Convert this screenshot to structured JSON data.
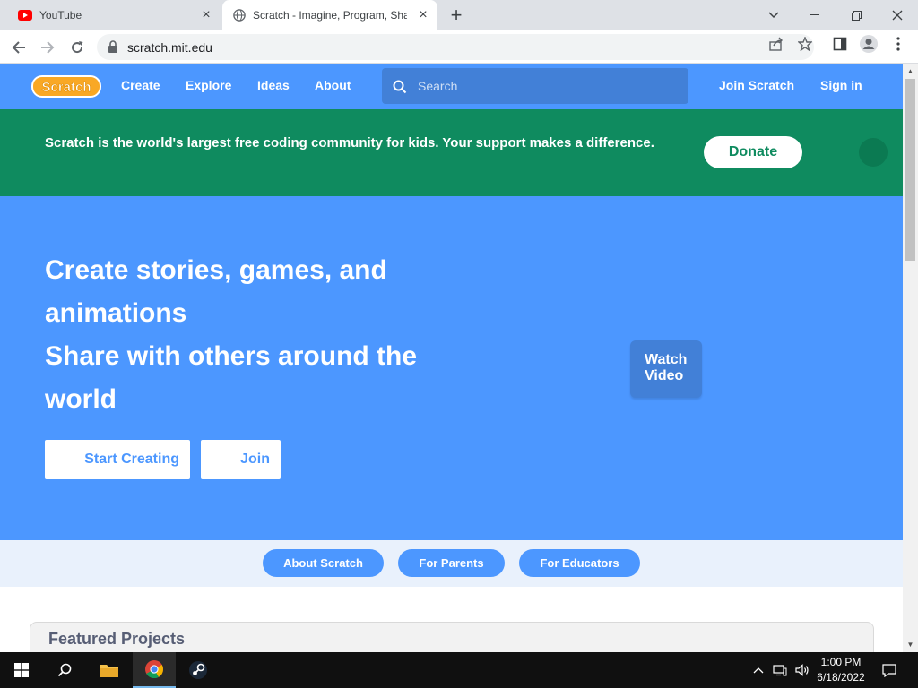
{
  "browser": {
    "tabs": [
      {
        "title": "YouTube",
        "icon": "youtube-icon"
      },
      {
        "title": "Scratch - Imagine, Program, Share",
        "icon": "globe-icon"
      }
    ],
    "url": "scratch.mit.edu"
  },
  "scratch_nav": {
    "logo": "Scratch",
    "links": [
      "Create",
      "Explore",
      "Ideas",
      "About"
    ],
    "search_placeholder": "Search",
    "join": "Join Scratch",
    "signin": "Sign in"
  },
  "donate_banner": {
    "text": "Scratch is the world's largest free coding community for kids. Your support makes a difference.",
    "button": "Donate"
  },
  "hero": {
    "lines": [
      "Create stories, games, and",
      "animations",
      "Share with others around the",
      "world"
    ],
    "start_button": "Start Creating",
    "join_button": "Join",
    "watch_video": "Watch Video"
  },
  "subnav": {
    "buttons": [
      "About Scratch",
      "For Parents",
      "For Educators"
    ]
  },
  "featured": {
    "title": "Featured Projects"
  },
  "taskbar": {
    "time": "1:00 PM",
    "date": "6/18/2022"
  },
  "colors": {
    "scratch_blue": "#4c97ff",
    "search_blue": "#4280d7",
    "donate_green": "#0f8b5f"
  }
}
